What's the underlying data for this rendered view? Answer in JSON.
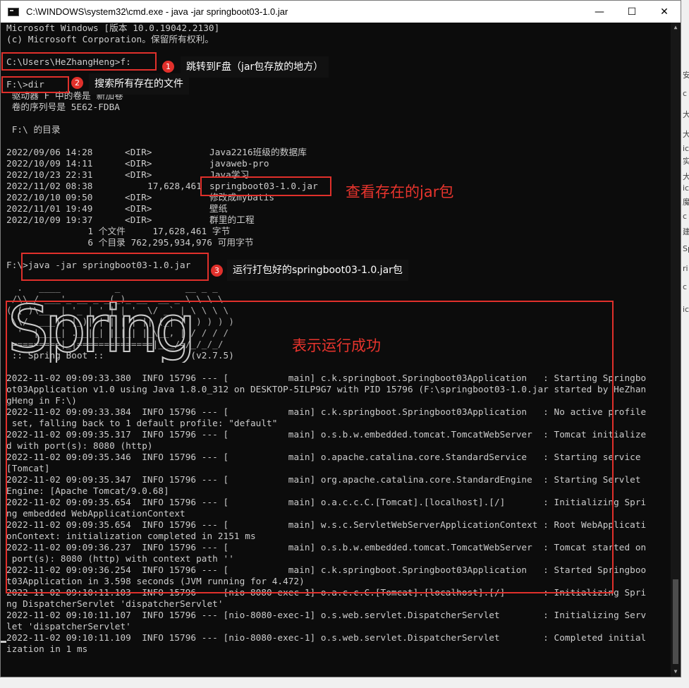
{
  "window": {
    "title": "C:\\WINDOWS\\system32\\cmd.exe - java  -jar springboot03-1.0.jar"
  },
  "controls": {
    "minimize": "—",
    "maximize": "☐",
    "close": "✕"
  },
  "header_lines": [
    "Microsoft Windows [版本 10.0.19042.2130]",
    "(c) Microsoft Corporation。保留所有权利。"
  ],
  "commands": {
    "cd": "C:\\Users\\HeZhangHeng>f:",
    "dir": "F:\\>dir",
    "run": "F:\\>java -jar springboot03-1.0.jar"
  },
  "dir_info": [
    " 驱动器 F 中的卷是 新加卷",
    " 卷的序列号是 5E62-FDBA",
    " F:\\ 的目录"
  ],
  "dir_entries": [
    {
      "date": "2022/09/06",
      "time": "14:28",
      "type": "<DIR>",
      "size": "",
      "name": "Java2216班级的数据库"
    },
    {
      "date": "2022/10/09",
      "time": "14:11",
      "type": "<DIR>",
      "size": "",
      "name": "javaweb-pro"
    },
    {
      "date": "2022/10/23",
      "time": "22:31",
      "type": "<DIR>",
      "size": "",
      "name": "Java学习"
    },
    {
      "date": "2022/11/02",
      "time": "08:38",
      "type": "",
      "size": "17,628,461",
      "name": "springboot03-1.0.jar"
    },
    {
      "date": "2022/10/10",
      "time": "09:50",
      "type": "<DIR>",
      "size": "",
      "name": "修改成mybatis"
    },
    {
      "date": "2022/11/01",
      "time": "19:49",
      "type": "<DIR>",
      "size": "",
      "name": "壁纸"
    },
    {
      "date": "2022/10/09",
      "time": "19:37",
      "type": "<DIR>",
      "size": "",
      "name": "群里的工程"
    }
  ],
  "dir_summary": [
    "               1 个文件     17,628,461 字节",
    "               6 个目录 762,295,934,976 可用字节"
  ],
  "banner": {
    "ascii": [
      "  .   ____          _            __ _ _",
      " /\\\\ / ___'_ __ _ _(_)_ __  __ _ \\ \\ \\ \\",
      "( ( )\\___ | '_ | '_| | '_ \\/ _` | \\ \\ \\ \\",
      " \\\\/  ___)| |_)| | | | | || (_| |  ) ) ) )",
      "  '  |____| .__|_| |_|_| |_\\__, | / / / /",
      " =========|_|==============|___/=/_/_/_/"
    ],
    "watermark": "Spring",
    "boot_line": " :: Spring Boot ::                (v2.7.5)"
  },
  "log_lines": [
    "2022-11-02 09:09:33.380  INFO 15796 --- [           main] c.k.springboot.Springboot03Application   : Starting Springbo",
    "ot03Application v1.0 using Java 1.8.0_312 on DESKTOP-5ILP9G7 with PID 15796 (F:\\springboot03-1.0.jar started by HeZhan",
    "gHeng in F:\\)",
    "2022-11-02 09:09:33.384  INFO 15796 --- [           main] c.k.springboot.Springboot03Application   : No active profile",
    " set, falling back to 1 default profile: \"default\"",
    "2022-11-02 09:09:35.317  INFO 15796 --- [           main] o.s.b.w.embedded.tomcat.TomcatWebServer  : Tomcat initialize",
    "d with port(s): 8080 (http)",
    "2022-11-02 09:09:35.346  INFO 15796 --- [           main] o.apache.catalina.core.StandardService   : Starting service",
    "[Tomcat]",
    "2022-11-02 09:09:35.347  INFO 15796 --- [           main] org.apache.catalina.core.StandardEngine  : Starting Servlet",
    "Engine: [Apache Tomcat/9.0.68]",
    "2022-11-02 09:09:35.654  INFO 15796 --- [           main] o.a.c.c.C.[Tomcat].[localhost].[/]       : Initializing Spri",
    "ng embedded WebApplicationContext",
    "2022-11-02 09:09:35.654  INFO 15796 --- [           main] w.s.c.ServletWebServerApplicationContext : Root WebApplicati",
    "onContext: initialization completed in 2151 ms",
    "2022-11-02 09:09:36.237  INFO 15796 --- [           main] o.s.b.w.embedded.tomcat.TomcatWebServer  : Tomcat started on",
    " port(s): 8080 (http) with context path ''",
    "2022-11-02 09:09:36.254  INFO 15796 --- [           main] c.k.springboot.Springboot03Application   : Started Springboo",
    "t03Application in 3.598 seconds (JVM running for 4.472)",
    "2022-11-02 09:10:11.103  INFO 15796 --- [nio-8080-exec-1] o.a.c.c.C.[Tomcat].[localhost].[/]       : Initializing Spri",
    "ng DispatcherServlet 'dispatcherServlet'",
    "2022-11-02 09:10:11.107  INFO 15796 --- [nio-8080-exec-1] o.s.web.servlet.DispatcherServlet        : Initializing Serv",
    "let 'dispatcherServlet'",
    "2022-11-02 09:10:11.109  INFO 15796 --- [nio-8080-exec-1] o.s.web.servlet.DispatcherServlet        : Completed initial",
    "ization in 1 ms"
  ],
  "annotations": {
    "a1": {
      "number": "1",
      "text": "跳转到F盘（jar包存放的地方）"
    },
    "a2": {
      "number": "2",
      "text": "搜索所有存在的文件"
    },
    "a3": {
      "text": "查看存在的jar包"
    },
    "a4": {
      "number": "3",
      "text": "运行打包好的springboot03-1.0.jar包"
    },
    "a5": {
      "text": "表示运行成功"
    }
  },
  "accent_color": "#e0302b",
  "background_chars": [
    "安",
    "c",
    "大",
    "大",
    "ic",
    "实",
    "大",
    "ic",
    "魔",
    "c",
    "建",
    "Sp",
    "ri",
    "c",
    "ic"
  ]
}
